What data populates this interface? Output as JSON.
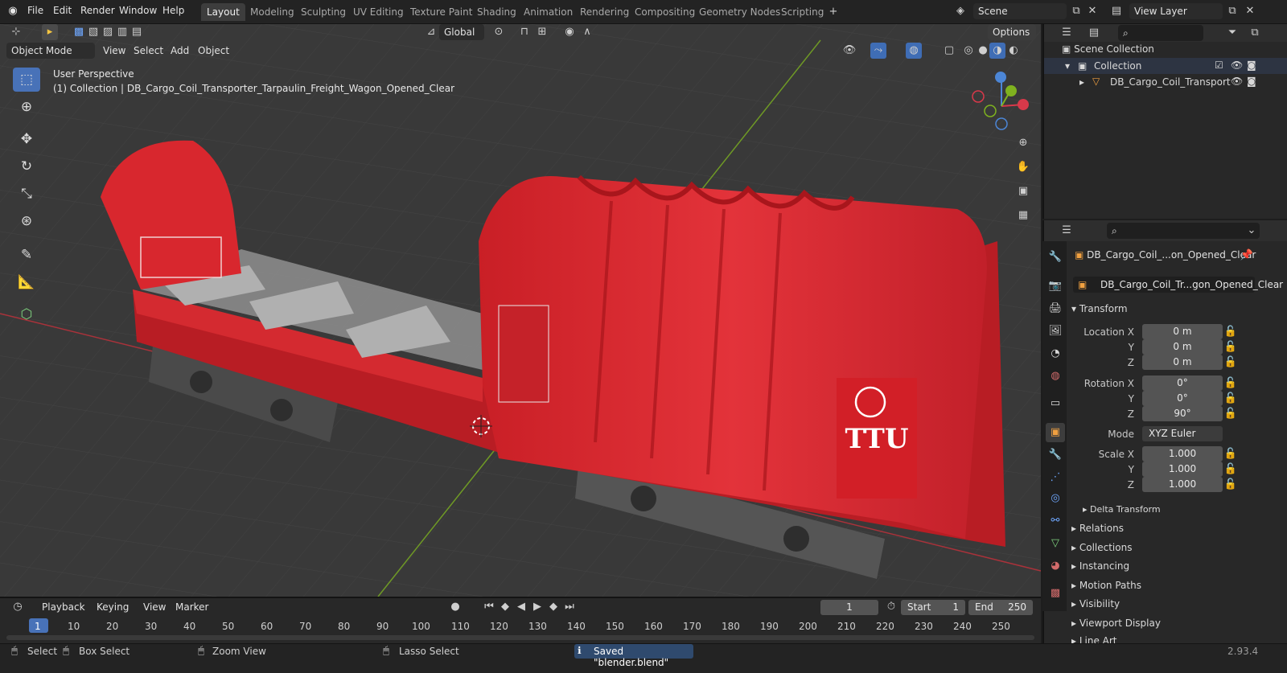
{
  "topbar": {
    "menus": [
      "File",
      "Edit",
      "Render",
      "Window",
      "Help"
    ],
    "workspaces": [
      "Layout",
      "Modeling",
      "Sculpting",
      "UV Editing",
      "Texture Paint",
      "Shading",
      "Animation",
      "Rendering",
      "Compositing",
      "Geometry Nodes",
      "Scripting"
    ],
    "active_workspace": "Layout",
    "scene_name": "Scene",
    "view_layer": "View Layer"
  },
  "viewport_header": {
    "mode": "Object Mode",
    "menus": [
      "View",
      "Select",
      "Add",
      "Object"
    ],
    "orientation": "Global",
    "options_label": "Options"
  },
  "viewport": {
    "perspective_label": "User Perspective",
    "collection_label": "(1) Collection | DB_Cargo_Coil_Transporter_Tarpaulin_Freight_Wagon_Opened_Clear",
    "object_text": "TTU",
    "colors": {
      "wagon": "#d9272b",
      "grid": "#3a3a3a",
      "bg": "#393939",
      "x_axis": "#c2323c",
      "y_axis": "#7fb21f"
    }
  },
  "outliner": {
    "scene_collection": "Scene Collection",
    "collection": "Collection",
    "object": "DB_Cargo_Coil_Transport"
  },
  "properties": {
    "object_name": "DB_Cargo_Coil_...on_Opened_Clear",
    "mesh_name": "DB_Cargo_Coil_Tr...gon_Opened_Clear",
    "transform_label": "Transform",
    "location_label": "Location X",
    "rotation_label": "Rotation X",
    "scale_label": "Scale X",
    "y_label": "Y",
    "z_label": "Z",
    "location": [
      "0 m",
      "0 m",
      "0 m"
    ],
    "rotation": [
      "0°",
      "0°",
      "90°"
    ],
    "mode_label": "Mode",
    "mode_value": "XYZ Euler",
    "scale": [
      "1.000",
      "1.000",
      "1.000"
    ],
    "delta_transform": "Delta Transform",
    "sections": [
      "Relations",
      "Collections",
      "Instancing",
      "Motion Paths",
      "Visibility",
      "Viewport Display",
      "Line Art"
    ]
  },
  "timeline": {
    "menus": [
      "Playback",
      "Keying",
      "View",
      "Marker"
    ],
    "current_frame": "1",
    "start_label": "Start",
    "start": "1",
    "end_label": "End",
    "end": "250",
    "ticks": [
      "1",
      "10",
      "20",
      "30",
      "40",
      "50",
      "60",
      "70",
      "80",
      "90",
      "100",
      "110",
      "120",
      "130",
      "140",
      "150",
      "160",
      "170",
      "180",
      "190",
      "200",
      "210",
      "220",
      "230",
      "240",
      "250"
    ]
  },
  "statusbar": {
    "select": "Select",
    "box_select": "Box Select",
    "zoom_view": "Zoom View",
    "lasso_select": "Lasso Select",
    "saved_message": "Saved \"blender.blend\"",
    "version": "2.93.4"
  }
}
